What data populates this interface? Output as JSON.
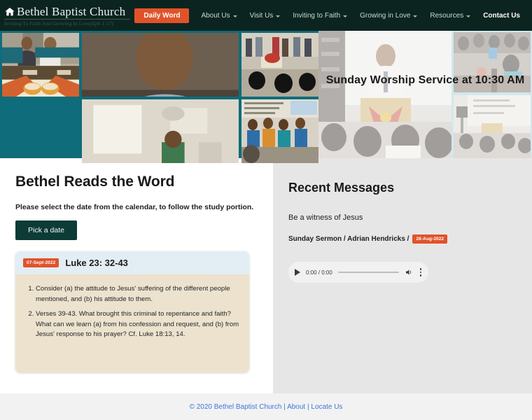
{
  "header": {
    "logo_icon": "home-icon",
    "brand_name": "Bethel Baptist Church",
    "tagline": "Inviting To Faith And Growing In Love",
    "tagline_ref": "(Eph 1:17)",
    "nav": [
      {
        "label": "Daily Word",
        "style": "primary",
        "has_caret": false
      },
      {
        "label": "About Us",
        "style": "link",
        "has_caret": true
      },
      {
        "label": "Visit Us",
        "style": "link",
        "has_caret": true
      },
      {
        "label": "Inviting to Faith",
        "style": "link",
        "has_caret": true
      },
      {
        "label": "Growing in Love",
        "style": "link",
        "has_caret": true
      },
      {
        "label": "Resources",
        "style": "link",
        "has_caret": true
      },
      {
        "label": "Contact Us",
        "style": "active",
        "has_caret": false
      }
    ]
  },
  "hero": {
    "caption": "Sunday Worship Service at 10:30 AM",
    "photos": [
      {
        "alt": "man speaking at microphone"
      },
      {
        "alt": "two men behind pulpit with communion table"
      },
      {
        "alt": "congregation standing at front of church"
      },
      {
        "alt": "seated congregation in church hall"
      },
      {
        "alt": "choir group singing in blue sarees"
      },
      {
        "alt": "preacher at pulpit before projector screen"
      },
      {
        "alt": "audience seated in meeting room"
      },
      {
        "alt": "group seated watching presentation"
      }
    ]
  },
  "left": {
    "title": "Bethel Reads the Word",
    "subtitle": "Please select the date from the calendar, to follow the study portion.",
    "pick_date_label": "Pick a date",
    "card": {
      "date_badge": "07-Sept-2022",
      "reference": "Luke 23: 32-43",
      "questions": [
        "Consider (a) the attitude to Jesus' suffering of the different people mentioned, and (b) his attitude to them.",
        "Verses 39-43. What brought this criminal to repentance and faith? What can we learn (a) from his confession and request, and (b) from Jesus' response to his prayer? Cf. Luke 18:13, 14."
      ]
    }
  },
  "right": {
    "title": "Recent Messages",
    "message": {
      "title": "Be a witness of Jesus",
      "meta": "Sunday Sermon / Adrian Hendricks /",
      "date_badge": "28-Aug-2022",
      "audio": {
        "play_icon": "play-icon",
        "time": "0:00 / 0:00",
        "volume_icon": "volume-icon",
        "menu_icon": "more-options-icon"
      }
    }
  },
  "footer": {
    "copyright": "© 2020 Bethel Baptist Church",
    "sep1": "|",
    "about": "About",
    "sep2": "|",
    "locate": "Locate Us"
  },
  "colors": {
    "header_bg": "#0c241f",
    "accent_orange": "#e0532a",
    "button_teal": "#0d3b35",
    "card_head": "#e2eef3",
    "card_body": "#ece2cd",
    "right_panel": "#e6e6e6",
    "footer_link": "#3c78d8",
    "collage_teal": "#0f6c7a",
    "hero_right_bg": "#8ecbd7"
  }
}
